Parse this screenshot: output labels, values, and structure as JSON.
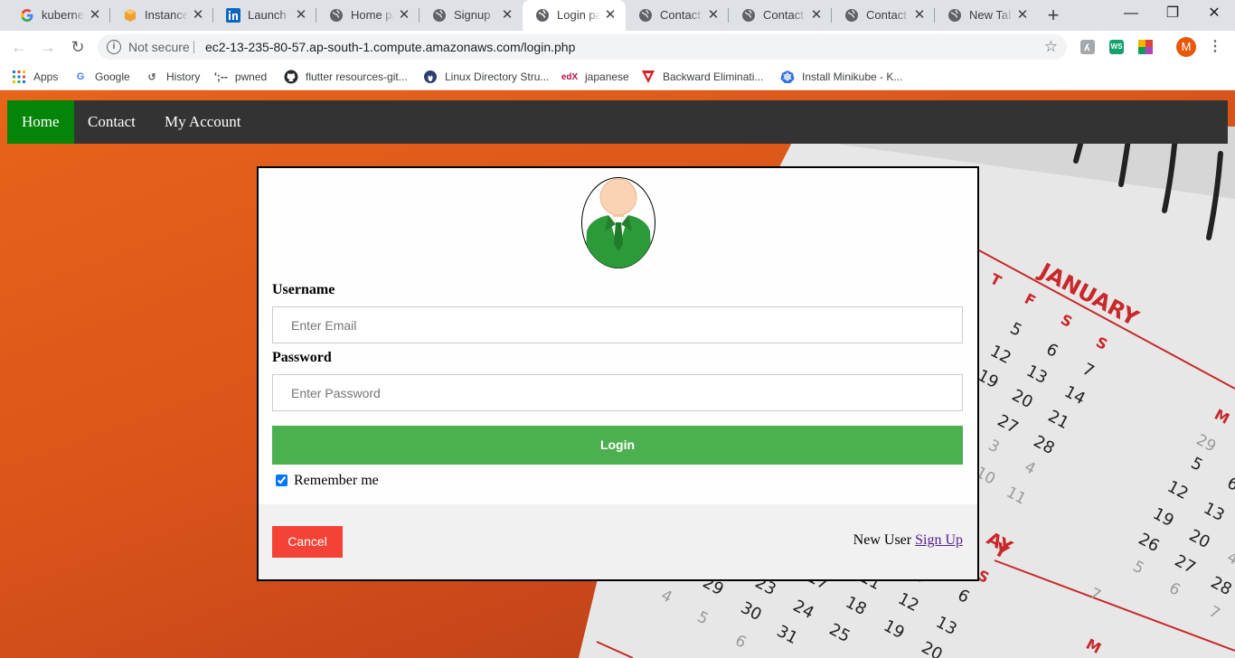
{
  "browser": {
    "tabs": [
      {
        "title": "kubernetes",
        "icon": "google-icon"
      },
      {
        "title": "Instances",
        "icon": "aws-icon"
      },
      {
        "title": "Launch W",
        "icon": "linkedin-icon"
      },
      {
        "title": "Home pa",
        "icon": "globe-icon"
      },
      {
        "title": "Signup",
        "icon": "globe-icon"
      },
      {
        "title": "Login pa",
        "icon": "globe-icon",
        "active": true
      },
      {
        "title": "Contact",
        "icon": "globe-icon"
      },
      {
        "title": "Contact",
        "icon": "globe-icon"
      },
      {
        "title": "Contact",
        "icon": "globe-icon"
      },
      {
        "title": "New Tab",
        "icon": "globe-icon"
      }
    ],
    "security_label": "Not secure",
    "url": "ec2-13-235-80-57.ap-south-1.compute.amazonaws.com/login.php",
    "profile_initial": "M",
    "bookmarks": [
      {
        "label": "Apps",
        "icon": "apps-grid-icon"
      },
      {
        "label": "Google",
        "icon": "google-icon"
      },
      {
        "label": "History",
        "icon": "history-icon"
      },
      {
        "label": "pwned",
        "prefix": "';--",
        "icon": "pwned-icon"
      },
      {
        "label": "flutter resources-git...",
        "icon": "github-icon"
      },
      {
        "label": "Linux Directory Stru...",
        "icon": "linux-icon"
      },
      {
        "label": "japanese",
        "icon": "edx-icon"
      },
      {
        "label": "Backward Eliminati...",
        "icon": "tv-logo-icon"
      },
      {
        "label": "Install Minikube - K...",
        "icon": "kubernetes-icon"
      }
    ],
    "extensions": [
      "WS"
    ]
  },
  "nav": {
    "links": [
      {
        "label": "Home",
        "active": true
      },
      {
        "label": "Contact"
      },
      {
        "label": "My Account"
      }
    ]
  },
  "calendar": {
    "month": "JANUARY",
    "weekday_letters": [
      "T",
      "F",
      "S",
      "S"
    ],
    "numbers": [
      "5",
      "6",
      "7",
      "12",
      "13",
      "14",
      "19",
      "20",
      "21",
      "27",
      "28",
      "3",
      "4",
      "10",
      "11",
      "29",
      "5",
      "6",
      "12",
      "13",
      "19",
      "20",
      "26",
      "27",
      "28",
      "5",
      "6",
      "7",
      "29",
      "23",
      "17",
      "11",
      "5",
      "6",
      "30",
      "24",
      "18",
      "12",
      "13",
      "31",
      "25",
      "19",
      "20",
      "4",
      "5",
      "6",
      "7",
      "Y",
      "AY",
      "S",
      "M",
      "M",
      "4"
    ]
  },
  "login": {
    "username_label": "Username",
    "username_placeholder": "Enter Email",
    "password_label": "Password",
    "password_placeholder": "Enter Password",
    "login_button": "Login",
    "remember_label": "Remember me",
    "remember_checked": true,
    "cancel_button": "Cancel",
    "new_user_text": "New User",
    "signup_link": "Sign Up"
  },
  "colors": {
    "nav_bg": "#333333",
    "nav_active": "#04850a",
    "login_green": "#4caf50",
    "cancel_red": "#f44336",
    "background_orange": "#e0601a"
  }
}
